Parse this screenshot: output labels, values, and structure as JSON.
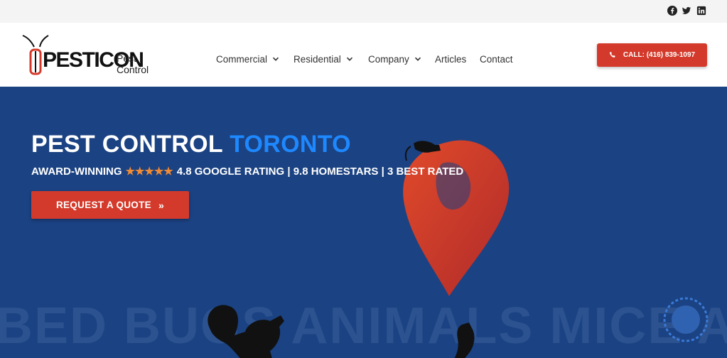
{
  "social": {
    "icons": [
      "facebook-icon",
      "twitter-icon",
      "linkedin-icon"
    ]
  },
  "logo": {
    "brand": "PESTICON",
    "pest": "Pest",
    "control": "Control"
  },
  "nav": {
    "items": [
      {
        "label": "Commercial",
        "has_dropdown": true
      },
      {
        "label": "Residential",
        "has_dropdown": true
      },
      {
        "label": "Company",
        "has_dropdown": true
      },
      {
        "label": "Articles",
        "has_dropdown": false
      },
      {
        "label": "Contact",
        "has_dropdown": false
      }
    ]
  },
  "call_button": {
    "label": "CALL: (416) 839-1097",
    "icon": "phone-icon"
  },
  "hero": {
    "title_main": "PEST CONTROL",
    "title_accent": "TORONTO",
    "subtitle_prefix": "AWARD-WINNING",
    "stars": "★★★★★",
    "subtitle_suffix": "4.8 GOOGLE RATING | 9.8 HOMESTARS | 3 BEST RATED",
    "quote_button": "REQUEST A QUOTE",
    "quote_arrows": "»",
    "background_words": "BED BUGS ANIMALS MICE ANTS"
  },
  "colors": {
    "hero_bg": "#1b4282",
    "accent_blue": "#1e88ff",
    "button_red": "#d43a2b",
    "star_orange": "#f08a33"
  }
}
